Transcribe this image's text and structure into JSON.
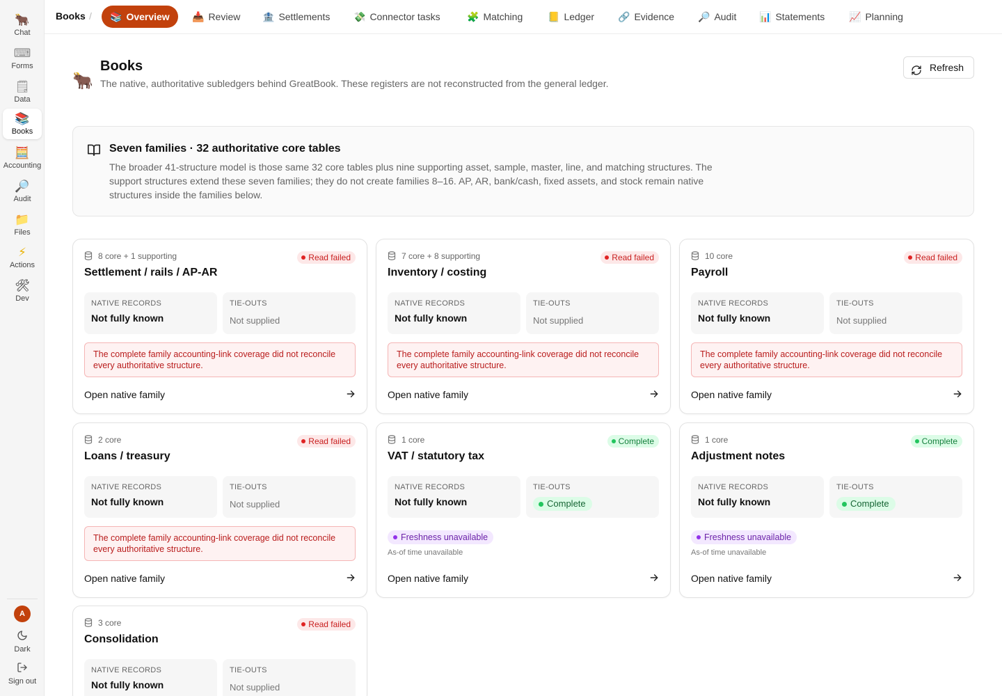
{
  "sidebar": {
    "items": [
      {
        "label": "Chat",
        "icon": "🐂"
      },
      {
        "label": "Forms",
        "icon": "⌨"
      },
      {
        "label": "Data",
        "icon": "🗒"
      },
      {
        "label": "Books",
        "icon": "📚"
      },
      {
        "label": "Accounting",
        "icon": "🧮"
      },
      {
        "label": "Audit",
        "icon": "🔎"
      },
      {
        "label": "Files",
        "icon": "📁"
      },
      {
        "label": "Actions",
        "icon": "⚡"
      },
      {
        "label": "Dev",
        "icon": "🛠"
      }
    ],
    "avatar": "A",
    "dark_label": "Dark",
    "signout_label": "Sign out"
  },
  "topnav": {
    "breadcrumb": "Books",
    "tabs": [
      {
        "label": "Overview",
        "icon": "📚"
      },
      {
        "label": "Review",
        "icon": "📥"
      },
      {
        "label": "Settlements",
        "icon": "🏦"
      },
      {
        "label": "Connector tasks",
        "icon": "💸"
      },
      {
        "label": "Matching",
        "icon": "🧩"
      },
      {
        "label": "Ledger",
        "icon": "📒"
      },
      {
        "label": "Evidence",
        "icon": "🔗"
      },
      {
        "label": "Audit",
        "icon": "🔎"
      },
      {
        "label": "Statements",
        "icon": "📊"
      },
      {
        "label": "Planning",
        "icon": "📈"
      }
    ]
  },
  "header": {
    "icon": "🐂",
    "title": "Books",
    "subtitle": "The native, authoritative subledgers behind GreatBook. These registers are not reconstructed from the general ledger.",
    "refresh_label": "Refresh"
  },
  "info": {
    "title": "Seven families · 32 authoritative core tables",
    "body": "The broader 41-structure model is those same 32 core tables plus nine supporting asset, sample, master, line, and matching structures. The support structures extend these seven families; they do not create families 8–16. AP, AR, bank/cash, fixed assets, and stock remain native structures inside the families below."
  },
  "card_labels": {
    "native_records": "NATIVE RECORDS",
    "tie_outs": "TIE-OUTS",
    "open": "Open native family"
  },
  "cards": [
    {
      "count": "8 core + 1 supporting",
      "title": "Settlement / rails / AP-AR",
      "status": "Read failed",
      "native": "Not fully known",
      "tieouts": "Not supplied",
      "warning": "The complete family accounting-link coverage did not reconcile every authoritative structure."
    },
    {
      "count": "7 core + 8 supporting",
      "title": "Inventory / costing",
      "status": "Read failed",
      "native": "Not fully known",
      "tieouts": "Not supplied",
      "warning": "The complete family accounting-link coverage did not reconcile every authoritative structure."
    },
    {
      "count": "10 core",
      "title": "Payroll",
      "status": "Read failed",
      "native": "Not fully known",
      "tieouts": "Not supplied",
      "warning": "The complete family accounting-link coverage did not reconcile every authoritative structure."
    },
    {
      "count": "2 core",
      "title": "Loans / treasury",
      "status": "Read failed",
      "native": "Not fully known",
      "tieouts": "Not supplied",
      "warning": "The complete family accounting-link coverage did not reconcile every authoritative structure."
    },
    {
      "count": "1 core",
      "title": "VAT / statutory tax",
      "status": "Complete",
      "native": "Not fully known",
      "tieouts": "Complete",
      "freshness": "Freshness unavailable",
      "asof": "As-of time unavailable"
    },
    {
      "count": "1 core",
      "title": "Adjustment notes",
      "status": "Complete",
      "native": "Not fully known",
      "tieouts": "Complete",
      "freshness": "Freshness unavailable",
      "asof": "As-of time unavailable"
    },
    {
      "count": "3 core",
      "title": "Consolidation",
      "status": "Read failed",
      "native": "Not fully known",
      "tieouts": "Not supplied"
    }
  ],
  "colors": {
    "accent": "#c2410c",
    "fail": "#c81e1e",
    "ok": "#15803d",
    "fresh": "#6b21a8"
  }
}
